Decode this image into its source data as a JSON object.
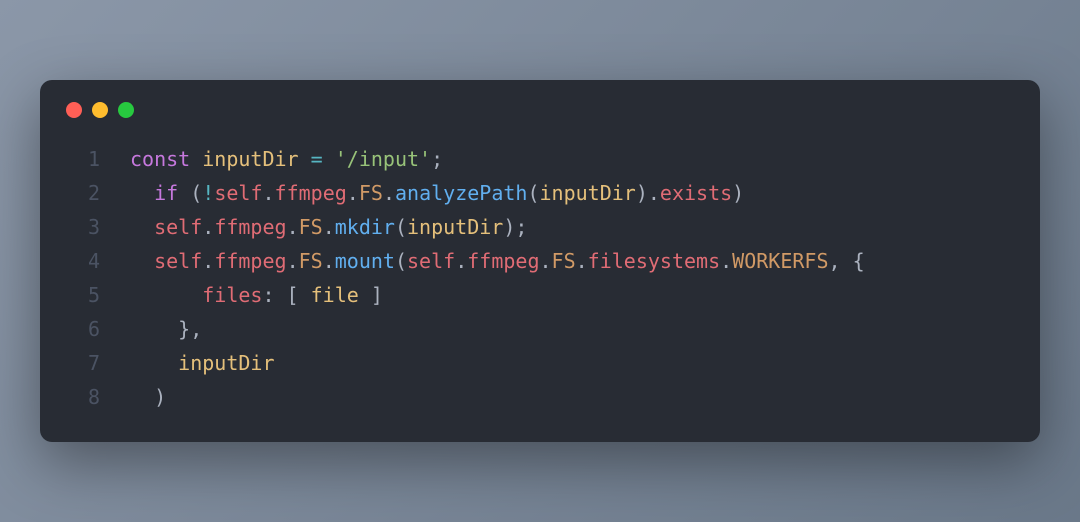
{
  "window": {
    "dots": [
      "red",
      "yellow",
      "green"
    ]
  },
  "code": {
    "lines": [
      {
        "n": "1",
        "tokens": [
          {
            "cls": "tok-kw",
            "t": "const"
          },
          {
            "cls": "tok-punc",
            "t": " "
          },
          {
            "cls": "tok-var",
            "t": "inputDir"
          },
          {
            "cls": "tok-punc",
            "t": " "
          },
          {
            "cls": "tok-op",
            "t": "="
          },
          {
            "cls": "tok-punc",
            "t": " "
          },
          {
            "cls": "tok-str",
            "t": "'/input'"
          },
          {
            "cls": "tok-punc",
            "t": ";"
          }
        ]
      },
      {
        "n": "2",
        "tokens": [
          {
            "cls": "tok-punc",
            "t": "  "
          },
          {
            "cls": "tok-kw",
            "t": "if"
          },
          {
            "cls": "tok-punc",
            "t": " ("
          },
          {
            "cls": "tok-op",
            "t": "!"
          },
          {
            "cls": "tok-prop",
            "t": "self"
          },
          {
            "cls": "tok-punc",
            "t": "."
          },
          {
            "cls": "tok-prop",
            "t": "ffmpeg"
          },
          {
            "cls": "tok-punc",
            "t": "."
          },
          {
            "cls": "tok-const",
            "t": "FS"
          },
          {
            "cls": "tok-punc",
            "t": "."
          },
          {
            "cls": "tok-func",
            "t": "analyzePath"
          },
          {
            "cls": "tok-punc",
            "t": "("
          },
          {
            "cls": "tok-var",
            "t": "inputDir"
          },
          {
            "cls": "tok-punc",
            "t": ")."
          },
          {
            "cls": "tok-prop",
            "t": "exists"
          },
          {
            "cls": "tok-punc",
            "t": ")"
          }
        ]
      },
      {
        "n": "3",
        "tokens": [
          {
            "cls": "tok-punc",
            "t": "  "
          },
          {
            "cls": "tok-prop",
            "t": "self"
          },
          {
            "cls": "tok-punc",
            "t": "."
          },
          {
            "cls": "tok-prop",
            "t": "ffmpeg"
          },
          {
            "cls": "tok-punc",
            "t": "."
          },
          {
            "cls": "tok-const",
            "t": "FS"
          },
          {
            "cls": "tok-punc",
            "t": "."
          },
          {
            "cls": "tok-func",
            "t": "mkdir"
          },
          {
            "cls": "tok-punc",
            "t": "("
          },
          {
            "cls": "tok-var",
            "t": "inputDir"
          },
          {
            "cls": "tok-punc",
            "t": ");"
          }
        ]
      },
      {
        "n": "4",
        "tokens": [
          {
            "cls": "tok-punc",
            "t": "  "
          },
          {
            "cls": "tok-prop",
            "t": "self"
          },
          {
            "cls": "tok-punc",
            "t": "."
          },
          {
            "cls": "tok-prop",
            "t": "ffmpeg"
          },
          {
            "cls": "tok-punc",
            "t": "."
          },
          {
            "cls": "tok-const",
            "t": "FS"
          },
          {
            "cls": "tok-punc",
            "t": "."
          },
          {
            "cls": "tok-func",
            "t": "mount"
          },
          {
            "cls": "tok-punc",
            "t": "("
          },
          {
            "cls": "tok-prop",
            "t": "self"
          },
          {
            "cls": "tok-punc",
            "t": "."
          },
          {
            "cls": "tok-prop",
            "t": "ffmpeg"
          },
          {
            "cls": "tok-punc",
            "t": "."
          },
          {
            "cls": "tok-const",
            "t": "FS"
          },
          {
            "cls": "tok-punc",
            "t": "."
          },
          {
            "cls": "tok-prop",
            "t": "filesystems"
          },
          {
            "cls": "tok-punc",
            "t": "."
          },
          {
            "cls": "tok-const",
            "t": "WORKERFS"
          },
          {
            "cls": "tok-punc",
            "t": ", {"
          }
        ]
      },
      {
        "n": "5",
        "tokens": [
          {
            "cls": "tok-punc",
            "t": "      "
          },
          {
            "cls": "tok-prop",
            "t": "files"
          },
          {
            "cls": "tok-punc",
            "t": ": [ "
          },
          {
            "cls": "tok-var",
            "t": "file"
          },
          {
            "cls": "tok-punc",
            "t": " ]"
          }
        ]
      },
      {
        "n": "6",
        "tokens": [
          {
            "cls": "tok-punc",
            "t": "    },"
          }
        ]
      },
      {
        "n": "7",
        "tokens": [
          {
            "cls": "tok-punc",
            "t": "    "
          },
          {
            "cls": "tok-var",
            "t": "inputDir"
          }
        ]
      },
      {
        "n": "8",
        "tokens": [
          {
            "cls": "tok-punc",
            "t": "  )"
          }
        ]
      }
    ]
  }
}
